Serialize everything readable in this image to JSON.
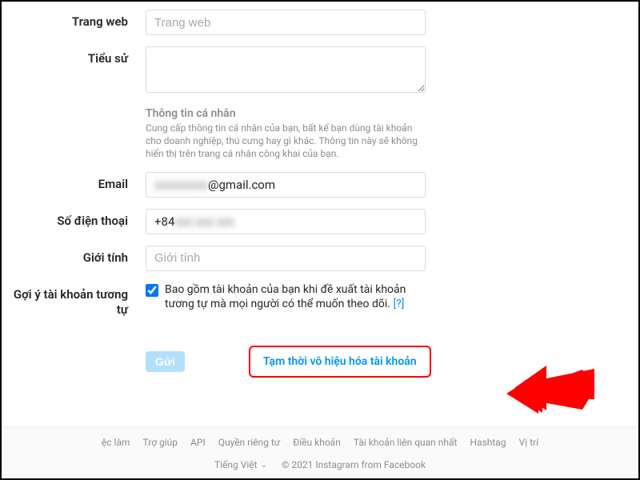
{
  "form": {
    "website": {
      "label": "Trang web",
      "placeholder": "Trang web",
      "value": ""
    },
    "bio": {
      "label": "Tiểu sử",
      "value": ""
    },
    "personalInfo": {
      "heading": "Thông tin cá nhân",
      "desc": "Cung cấp thông tin cá nhân của bạn, bất kể bạn dùng tài khoản cho doanh nghiệp, thú cưng hay gì khác. Thông tin này sẽ không hiển thị trên trang cá nhân công khai của bạn."
    },
    "email": {
      "label": "Email",
      "value_redacted": "xxxxxxxxx",
      "value_suffix": "@gmail.com"
    },
    "phone": {
      "label": "Số điện thoại",
      "value_prefix": "+84",
      "value_redacted": " xxx xxx xxx"
    },
    "gender": {
      "label": "Giới tính",
      "placeholder": "Giới tính",
      "value": ""
    },
    "similar": {
      "label": "Gợi ý tài khoản tương tự",
      "checked": true,
      "text": "Bao gồm tài khoản của bạn khi đề xuất tài khoản tương tự mà mọi người có thể muốn theo dõi.",
      "help": "[?]"
    },
    "submit": "Gửi",
    "disableLink": "Tạm thời vô hiệu hóa tài khoản"
  },
  "footer": {
    "links": [
      "ệc làm",
      "Trợ giúp",
      "API",
      "Quyền riêng tư",
      "Điều khoản",
      "Tài khoản liên quan nhất",
      "Hashtag",
      "Vị trí"
    ],
    "language": "Tiếng Việt",
    "copyright": "© 2021 Instagram from Facebook"
  }
}
